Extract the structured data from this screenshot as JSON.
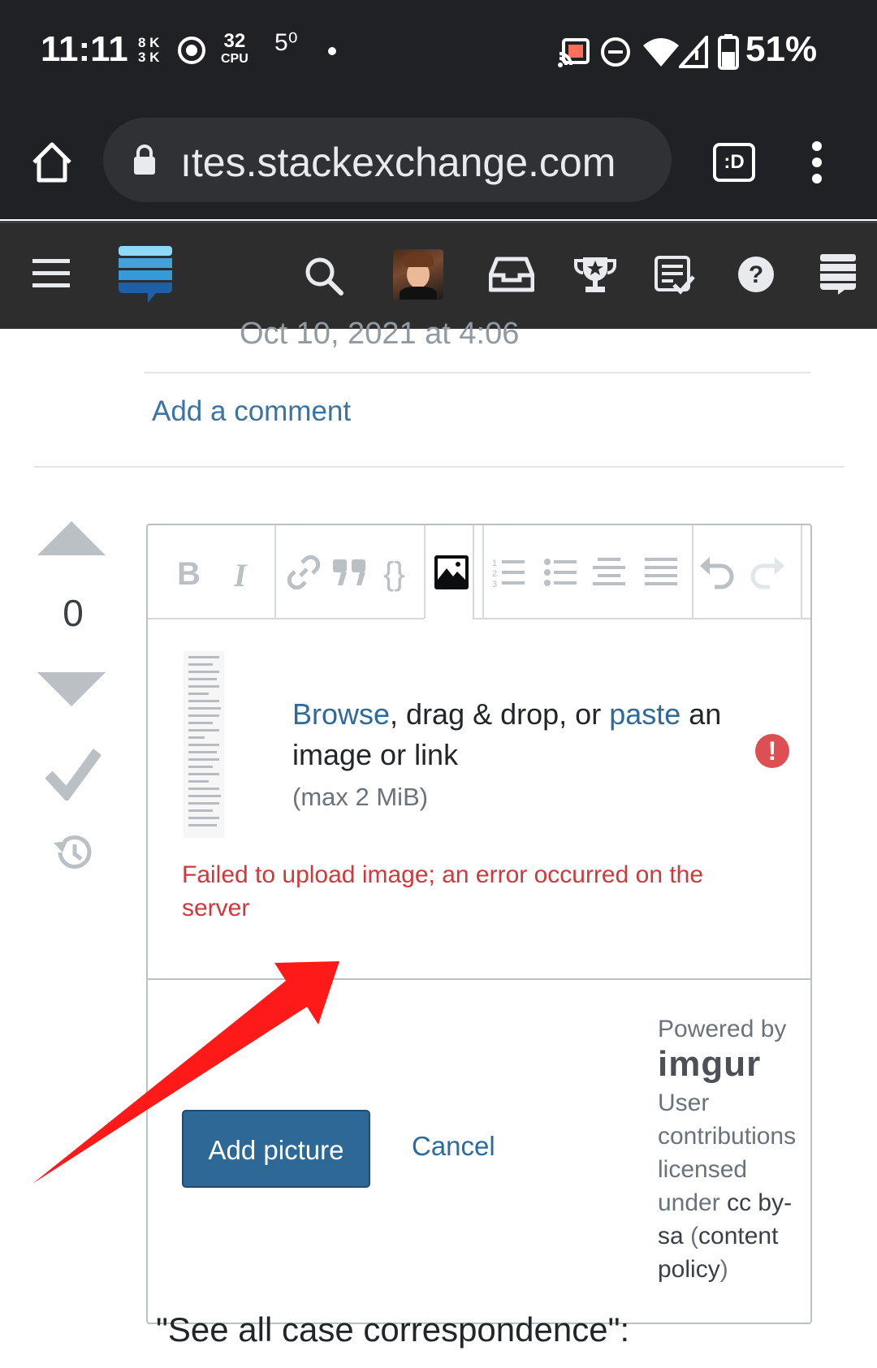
{
  "status_bar": {
    "time": "11:11",
    "net_up": "8 K",
    "net_down": "3 K",
    "cpu_value": "32",
    "cpu_label": "CPU",
    "temp": "5⁰",
    "battery": "51%"
  },
  "browser": {
    "url": "ıtes.stackexchange.com",
    "tab_icon_label": ":D"
  },
  "post": {
    "timestamp": "Oct 10, 2021 at 4:06",
    "add_comment": "Add a comment",
    "vote_count": "0",
    "trailing_text": "\"See all case correspondence\":"
  },
  "editor": {
    "toolbar": {
      "bold": "B",
      "italic": "I",
      "code": "{}"
    },
    "upload": {
      "browse": "Browse",
      "text_mid": ", drag & drop, or ",
      "paste": "paste",
      "text_end": " an image or link",
      "max_size": "(max 2 MiB)",
      "error_icon": "!",
      "error_message": "Failed to upload image; an error occurred on the server"
    },
    "add_picture": "Add picture",
    "cancel": "Cancel",
    "powered_by": "Powered by",
    "imgur": "imgur",
    "license_1": "User contributions licensed under ",
    "license_link": "cc by-sa",
    "license_2": " (",
    "license_link2": "content policy",
    "license_3": ")"
  },
  "colors": {
    "accent_link": "#2f6a9c",
    "error": "#d1383d",
    "button": "#2e6896",
    "annotation_arrow": "#ff1a1a"
  }
}
